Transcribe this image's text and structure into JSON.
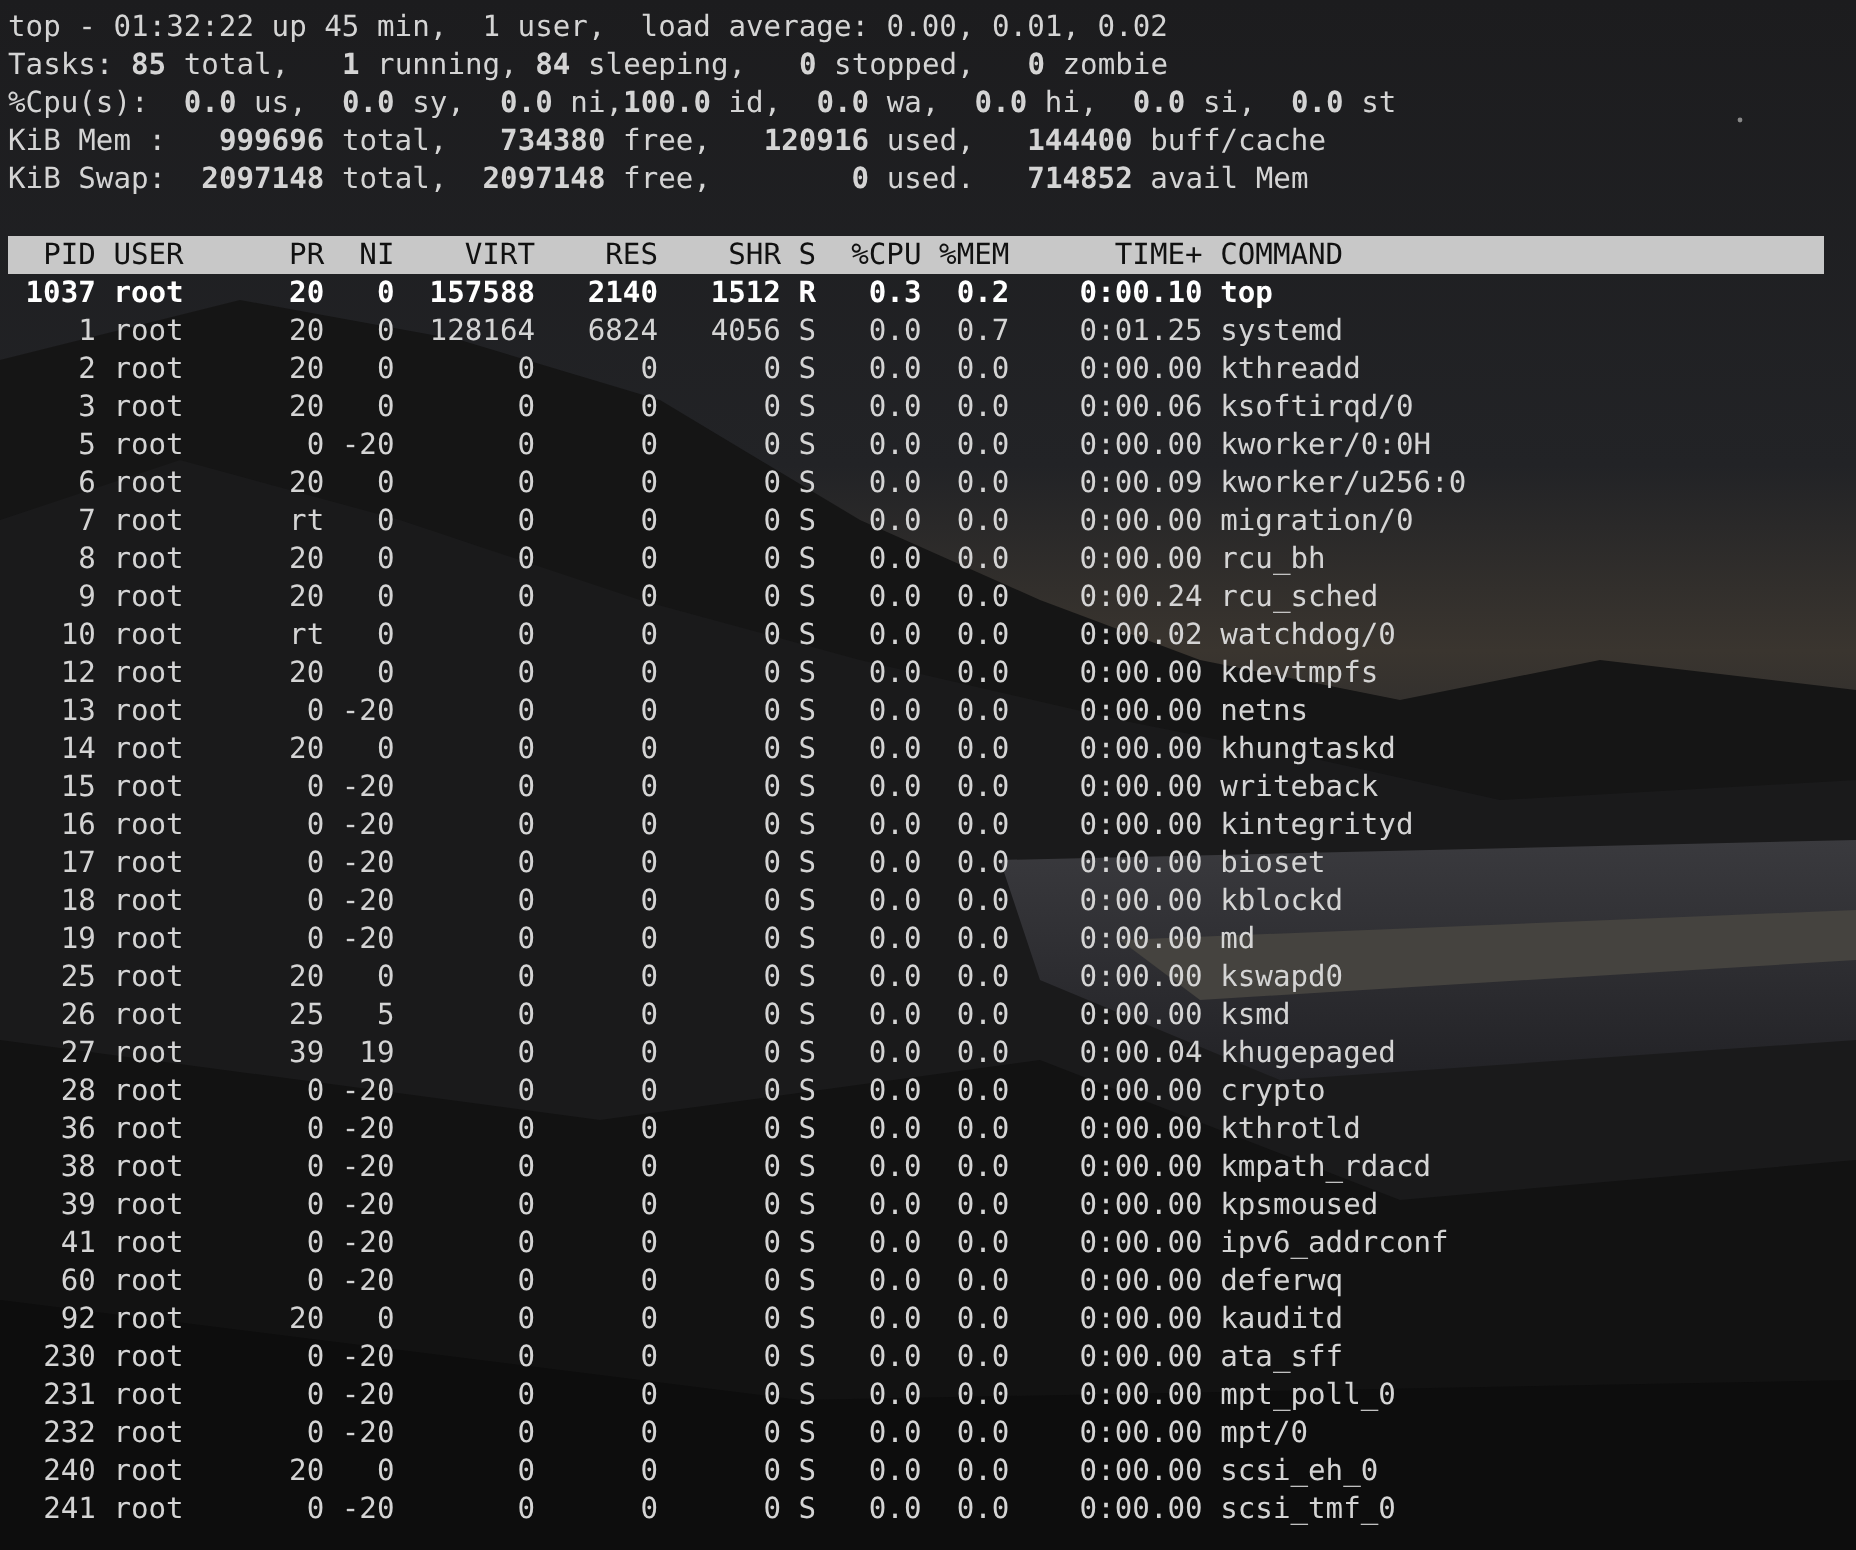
{
  "summary": [
    "top - 01:32:22 up 45 min,  1 user,  load average: 0.00, 0.01, 0.02",
    "Tasks: **85** total,   **1** running, **84** sleeping,   **0** stopped,   **0** zombie",
    "%Cpu(s):  **0.0** us,  **0.0** sy,  **0.0** ni,**100.0** id,  **0.0** wa,  **0.0** hi,  **0.0** si,  **0.0** st",
    "KiB Mem :   **999696** total,   **734380** free,   **120916** used,   **144400** buff/cache",
    "KiB Swap:  **2097148** total,  **2097148** free,        **0** used.   **714852** avail Mem"
  ],
  "table": {
    "columns": [
      "PID",
      "USER",
      "PR",
      "NI",
      "VIRT",
      "RES",
      "SHR",
      "S",
      "%CPU",
      "%MEM",
      "TIME+",
      "COMMAND"
    ],
    "rows": [
      {
        "highlighted": true,
        "cells": [
          "1037",
          "root",
          "20",
          "0",
          "157588",
          "2140",
          "1512",
          "R",
          "0.3",
          "0.2",
          "0:00.10",
          "top"
        ]
      },
      {
        "highlighted": false,
        "cells": [
          "1",
          "root",
          "20",
          "0",
          "128164",
          "6824",
          "4056",
          "S",
          "0.0",
          "0.7",
          "0:01.25",
          "systemd"
        ]
      },
      {
        "highlighted": false,
        "cells": [
          "2",
          "root",
          "20",
          "0",
          "0",
          "0",
          "0",
          "S",
          "0.0",
          "0.0",
          "0:00.00",
          "kthreadd"
        ]
      },
      {
        "highlighted": false,
        "cells": [
          "3",
          "root",
          "20",
          "0",
          "0",
          "0",
          "0",
          "S",
          "0.0",
          "0.0",
          "0:00.06",
          "ksoftirqd/0"
        ]
      },
      {
        "highlighted": false,
        "cells": [
          "5",
          "root",
          "0",
          "-20",
          "0",
          "0",
          "0",
          "S",
          "0.0",
          "0.0",
          "0:00.00",
          "kworker/0:0H"
        ]
      },
      {
        "highlighted": false,
        "cells": [
          "6",
          "root",
          "20",
          "0",
          "0",
          "0",
          "0",
          "S",
          "0.0",
          "0.0",
          "0:00.09",
          "kworker/u256:0"
        ]
      },
      {
        "highlighted": false,
        "cells": [
          "7",
          "root",
          "rt",
          "0",
          "0",
          "0",
          "0",
          "S",
          "0.0",
          "0.0",
          "0:00.00",
          "migration/0"
        ]
      },
      {
        "highlighted": false,
        "cells": [
          "8",
          "root",
          "20",
          "0",
          "0",
          "0",
          "0",
          "S",
          "0.0",
          "0.0",
          "0:00.00",
          "rcu_bh"
        ]
      },
      {
        "highlighted": false,
        "cells": [
          "9",
          "root",
          "20",
          "0",
          "0",
          "0",
          "0",
          "S",
          "0.0",
          "0.0",
          "0:00.24",
          "rcu_sched"
        ]
      },
      {
        "highlighted": false,
        "cells": [
          "10",
          "root",
          "rt",
          "0",
          "0",
          "0",
          "0",
          "S",
          "0.0",
          "0.0",
          "0:00.02",
          "watchdog/0"
        ]
      },
      {
        "highlighted": false,
        "cells": [
          "12",
          "root",
          "20",
          "0",
          "0",
          "0",
          "0",
          "S",
          "0.0",
          "0.0",
          "0:00.00",
          "kdevtmpfs"
        ]
      },
      {
        "highlighted": false,
        "cells": [
          "13",
          "root",
          "0",
          "-20",
          "0",
          "0",
          "0",
          "S",
          "0.0",
          "0.0",
          "0:00.00",
          "netns"
        ]
      },
      {
        "highlighted": false,
        "cells": [
          "14",
          "root",
          "20",
          "0",
          "0",
          "0",
          "0",
          "S",
          "0.0",
          "0.0",
          "0:00.00",
          "khungtaskd"
        ]
      },
      {
        "highlighted": false,
        "cells": [
          "15",
          "root",
          "0",
          "-20",
          "0",
          "0",
          "0",
          "S",
          "0.0",
          "0.0",
          "0:00.00",
          "writeback"
        ]
      },
      {
        "highlighted": false,
        "cells": [
          "16",
          "root",
          "0",
          "-20",
          "0",
          "0",
          "0",
          "S",
          "0.0",
          "0.0",
          "0:00.00",
          "kintegrityd"
        ]
      },
      {
        "highlighted": false,
        "cells": [
          "17",
          "root",
          "0",
          "-20",
          "0",
          "0",
          "0",
          "S",
          "0.0",
          "0.0",
          "0:00.00",
          "bioset"
        ]
      },
      {
        "highlighted": false,
        "cells": [
          "18",
          "root",
          "0",
          "-20",
          "0",
          "0",
          "0",
          "S",
          "0.0",
          "0.0",
          "0:00.00",
          "kblockd"
        ]
      },
      {
        "highlighted": false,
        "cells": [
          "19",
          "root",
          "0",
          "-20",
          "0",
          "0",
          "0",
          "S",
          "0.0",
          "0.0",
          "0:00.00",
          "md"
        ]
      },
      {
        "highlighted": false,
        "cells": [
          "25",
          "root",
          "20",
          "0",
          "0",
          "0",
          "0",
          "S",
          "0.0",
          "0.0",
          "0:00.00",
          "kswapd0"
        ]
      },
      {
        "highlighted": false,
        "cells": [
          "26",
          "root",
          "25",
          "5",
          "0",
          "0",
          "0",
          "S",
          "0.0",
          "0.0",
          "0:00.00",
          "ksmd"
        ]
      },
      {
        "highlighted": false,
        "cells": [
          "27",
          "root",
          "39",
          "19",
          "0",
          "0",
          "0",
          "S",
          "0.0",
          "0.0",
          "0:00.04",
          "khugepaged"
        ]
      },
      {
        "highlighted": false,
        "cells": [
          "28",
          "root",
          "0",
          "-20",
          "0",
          "0",
          "0",
          "S",
          "0.0",
          "0.0",
          "0:00.00",
          "crypto"
        ]
      },
      {
        "highlighted": false,
        "cells": [
          "36",
          "root",
          "0",
          "-20",
          "0",
          "0",
          "0",
          "S",
          "0.0",
          "0.0",
          "0:00.00",
          "kthrotld"
        ]
      },
      {
        "highlighted": false,
        "cells": [
          "38",
          "root",
          "0",
          "-20",
          "0",
          "0",
          "0",
          "S",
          "0.0",
          "0.0",
          "0:00.00",
          "kmpath_rdacd"
        ]
      },
      {
        "highlighted": false,
        "cells": [
          "39",
          "root",
          "0",
          "-20",
          "0",
          "0",
          "0",
          "S",
          "0.0",
          "0.0",
          "0:00.00",
          "kpsmoused"
        ]
      },
      {
        "highlighted": false,
        "cells": [
          "41",
          "root",
          "0",
          "-20",
          "0",
          "0",
          "0",
          "S",
          "0.0",
          "0.0",
          "0:00.00",
          "ipv6_addrconf"
        ]
      },
      {
        "highlighted": false,
        "cells": [
          "60",
          "root",
          "0",
          "-20",
          "0",
          "0",
          "0",
          "S",
          "0.0",
          "0.0",
          "0:00.00",
          "deferwq"
        ]
      },
      {
        "highlighted": false,
        "cells": [
          "92",
          "root",
          "20",
          "0",
          "0",
          "0",
          "0",
          "S",
          "0.0",
          "0.0",
          "0:00.00",
          "kauditd"
        ]
      },
      {
        "highlighted": false,
        "cells": [
          "230",
          "root",
          "0",
          "-20",
          "0",
          "0",
          "0",
          "S",
          "0.0",
          "0.0",
          "0:00.00",
          "ata_sff"
        ]
      },
      {
        "highlighted": false,
        "cells": [
          "231",
          "root",
          "0",
          "-20",
          "0",
          "0",
          "0",
          "S",
          "0.0",
          "0.0",
          "0:00.00",
          "mpt_poll_0"
        ]
      },
      {
        "highlighted": false,
        "cells": [
          "232",
          "root",
          "0",
          "-20",
          "0",
          "0",
          "0",
          "S",
          "0.0",
          "0.0",
          "0:00.00",
          "mpt/0"
        ]
      },
      {
        "highlighted": false,
        "cells": [
          "240",
          "root",
          "20",
          "0",
          "0",
          "0",
          "0",
          "S",
          "0.0",
          "0.0",
          "0:00.00",
          "scsi_eh_0"
        ]
      },
      {
        "highlighted": false,
        "cells": [
          "241",
          "root",
          "0",
          "-20",
          "0",
          "0",
          "0",
          "S",
          "0.0",
          "0.0",
          "0:00.00",
          "scsi_tmf_0"
        ]
      }
    ]
  }
}
